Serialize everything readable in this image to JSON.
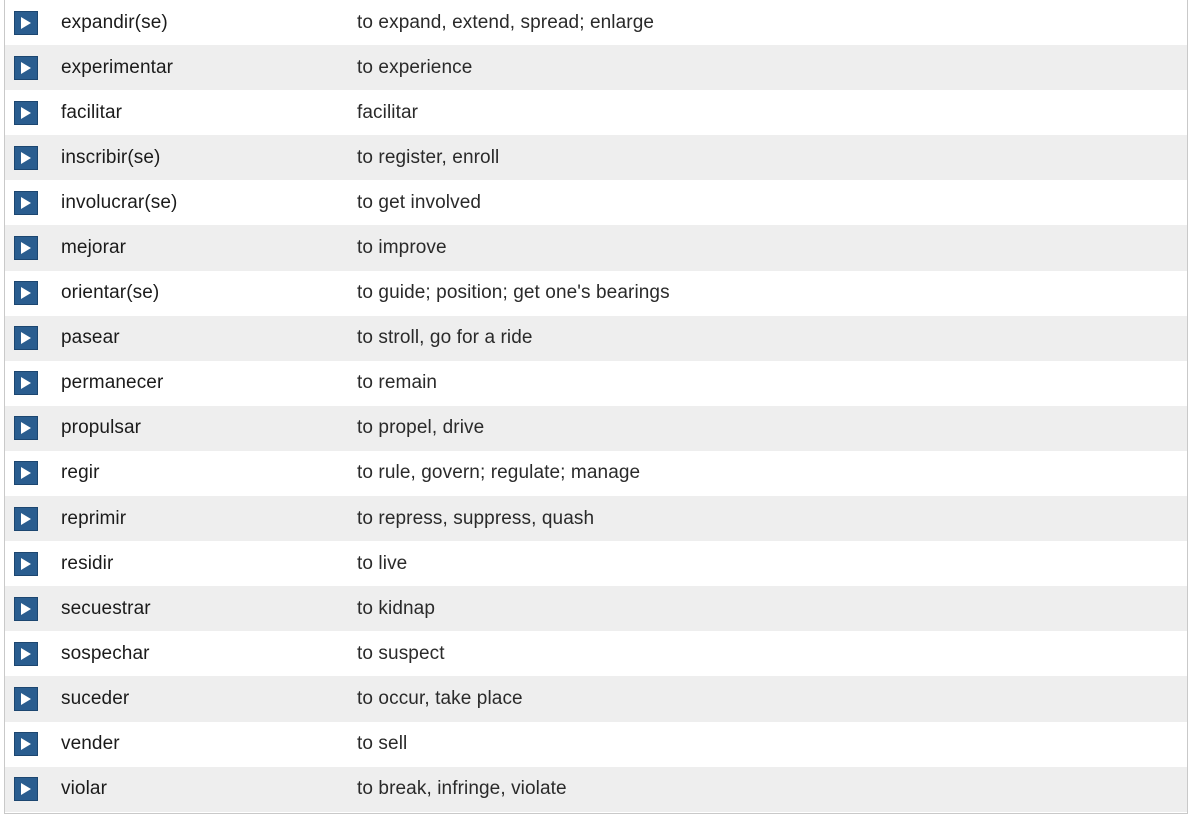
{
  "vocabulary": {
    "rows": [
      {
        "term": "expandir(se)",
        "definition": "to expand, extend, spread; enlarge"
      },
      {
        "term": "experimentar",
        "definition": "to experience"
      },
      {
        "term": "facilitar",
        "definition": "facilitar"
      },
      {
        "term": "inscribir(se)",
        "definition": "to register, enroll"
      },
      {
        "term": "involucrar(se)",
        "definition": "to get involved"
      },
      {
        "term": "mejorar",
        "definition": "to improve"
      },
      {
        "term": "orientar(se)",
        "definition": "to guide; position; get one's bearings"
      },
      {
        "term": "pasear",
        "definition": "to stroll, go for a ride"
      },
      {
        "term": "permanecer",
        "definition": "to remain"
      },
      {
        "term": "propulsar",
        "definition": "to propel, drive"
      },
      {
        "term": "regir",
        "definition": "to rule, govern; regulate; manage"
      },
      {
        "term": "reprimir",
        "definition": "to repress, suppress, quash"
      },
      {
        "term": "residir",
        "definition": "to live"
      },
      {
        "term": "secuestrar",
        "definition": "to kidnap"
      },
      {
        "term": "sospechar",
        "definition": "to suspect"
      },
      {
        "term": "suceder",
        "definition": "to occur, take place"
      },
      {
        "term": "vender",
        "definition": "to sell"
      },
      {
        "term": "violar",
        "definition": "to break, infringe, violate"
      }
    ]
  },
  "icons": {
    "play": "play-icon"
  },
  "colors": {
    "play_button": "#2a5d8f",
    "row_alt": "#eeeeee"
  }
}
